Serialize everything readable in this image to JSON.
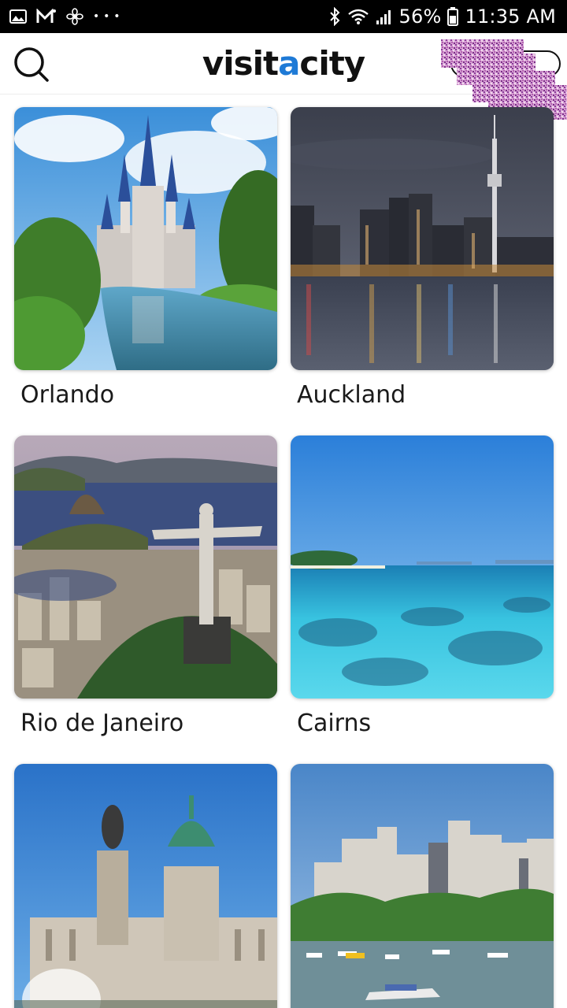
{
  "status_bar": {
    "notification_icons": [
      "image-icon",
      "gmail-icon",
      "fan-icon",
      "more-dots-icon"
    ],
    "more_dots": "• • •",
    "battery_percent": "56%",
    "time": "11:35 AM"
  },
  "header": {
    "logo_part1": "visit",
    "logo_accent": "a",
    "logo_part2": "city",
    "accent_color": "#1e7ad6"
  },
  "cities": [
    {
      "name": "Orlando"
    },
    {
      "name": "Auckland"
    },
    {
      "name": "Rio de Janeiro"
    },
    {
      "name": "Cairns"
    },
    {
      "name": ""
    },
    {
      "name": ""
    }
  ]
}
